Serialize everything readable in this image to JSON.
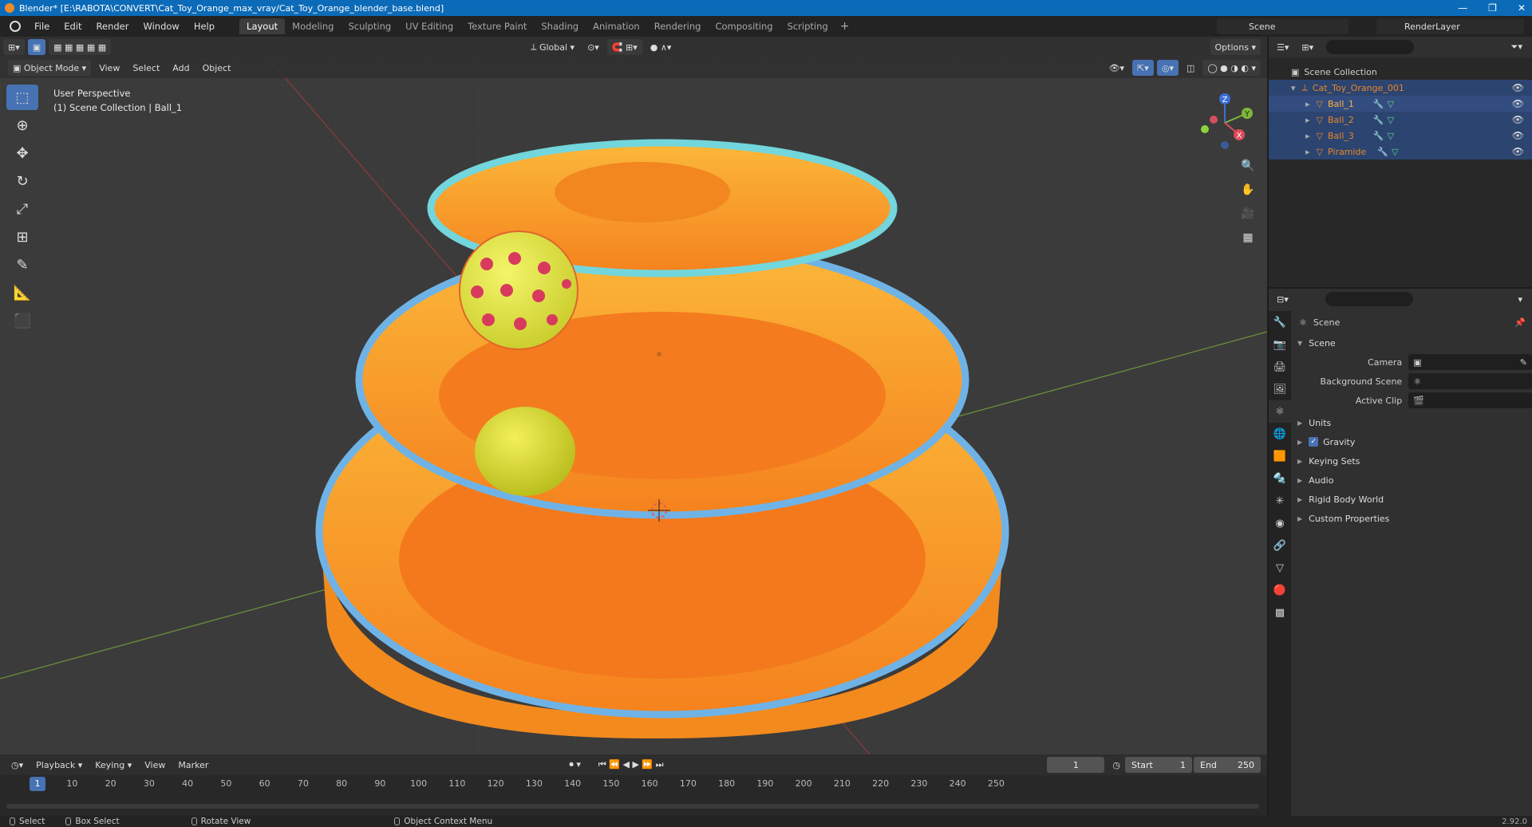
{
  "window": {
    "title": "Blender* [E:\\RABOTA\\CONVERT\\Cat_Toy_Orange_max_vray/Cat_Toy_Orange_blender_base.blend]",
    "controls": [
      "—",
      "❐",
      "✕"
    ]
  },
  "menu": [
    "File",
    "Edit",
    "Render",
    "Window",
    "Help"
  ],
  "workspaces": [
    "Layout",
    "Modeling",
    "Sculpting",
    "UV Editing",
    "Texture Paint",
    "Shading",
    "Animation",
    "Rendering",
    "Compositing",
    "Scripting"
  ],
  "active_workspace": "Layout",
  "scene_selector": "Scene",
  "render_layer": "RenderLayer",
  "viewport": {
    "transform_orientation": "Global",
    "options_label": "Options",
    "mode": "Object Mode",
    "menus": [
      "View",
      "Select",
      "Add",
      "Object"
    ],
    "info_line1": "User Perspective",
    "info_line2": "(1) Scene Collection | Ball_1",
    "gizmo_axes": {
      "x": "X",
      "y": "Y",
      "z": "Z"
    }
  },
  "outliner": {
    "root": "Scene Collection",
    "collection": "Cat_Toy_Orange_001",
    "objects": [
      "Ball_1",
      "Ball_2",
      "Ball_3",
      "Piramide"
    ],
    "active_object": "Ball_1"
  },
  "properties": {
    "header": "Scene",
    "panel": "Scene",
    "camera_label": "Camera",
    "background_scene_label": "Background Scene",
    "active_clip_label": "Active Clip",
    "subpanels": [
      "Units",
      "Gravity",
      "Keying Sets",
      "Audio",
      "Rigid Body World",
      "Custom Properties"
    ],
    "gravity_checked": true
  },
  "timeline": {
    "menus": [
      "Playback",
      "Keying",
      "View",
      "Marker"
    ],
    "current_frame": "1",
    "start_label": "Start",
    "start": "1",
    "end_label": "End",
    "end": "250",
    "ruler": [
      "1",
      "10",
      "20",
      "30",
      "40",
      "50",
      "60",
      "70",
      "80",
      "90",
      "100",
      "110",
      "120",
      "130",
      "140",
      "150",
      "160",
      "170",
      "180",
      "190",
      "200",
      "210",
      "220",
      "230",
      "240",
      "250"
    ]
  },
  "statusbar": {
    "select": "Select",
    "box_select": "Box Select",
    "rotate_view": "Rotate View",
    "context_menu": "Object Context Menu",
    "version": "2.92.0"
  },
  "colors": {
    "accent": "#4772b3",
    "title_bar": "#0c6bb8",
    "toy_orange": "#f7a127",
    "toy_blue_rim": "#5fb4e8",
    "object_orange": "#e8862a"
  }
}
